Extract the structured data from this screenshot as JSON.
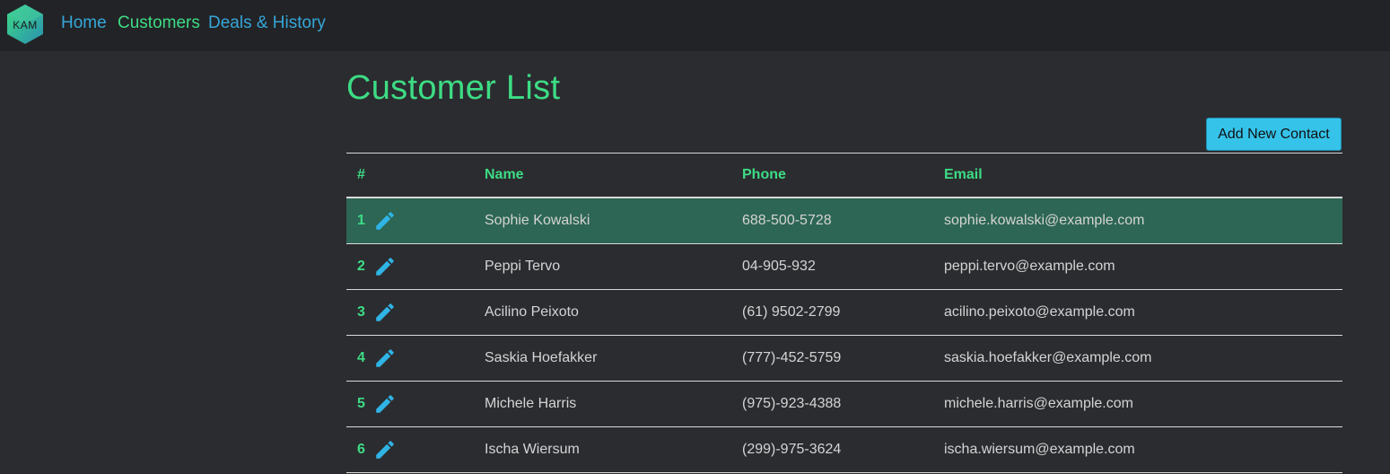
{
  "theme": {
    "accent_green": "#3ddc84",
    "accent_blue": "#35a7d9",
    "button_blue": "#35c3ea",
    "highlight_row": "#2d6654",
    "pencil_blue": "#2fb4e6"
  },
  "navbar": {
    "logo_text": "KAM",
    "links": [
      {
        "label": "Home"
      },
      {
        "label": "Customers"
      },
      {
        "label": "Deals & History"
      }
    ]
  },
  "page": {
    "title": "Customer List",
    "add_button_label": "Add New Contact"
  },
  "table": {
    "headers": [
      "#",
      "Name",
      "Phone",
      "Email"
    ],
    "rows": [
      {
        "num": "1",
        "name": "Sophie Kowalski",
        "phone": "688-500-5728",
        "email": "sophie.kowalski@example.com",
        "highlighted": true
      },
      {
        "num": "2",
        "name": "Peppi Tervo",
        "phone": "04-905-932",
        "email": "peppi.tervo@example.com",
        "highlighted": false
      },
      {
        "num": "3",
        "name": "Acilino Peixoto",
        "phone": "(61) 9502-2799",
        "email": "acilino.peixoto@example.com",
        "highlighted": false
      },
      {
        "num": "4",
        "name": "Saskia Hoefakker",
        "phone": "(777)-452-5759",
        "email": "saskia.hoefakker@example.com",
        "highlighted": false
      },
      {
        "num": "5",
        "name": "Michele Harris",
        "phone": "(975)-923-4388",
        "email": "michele.harris@example.com",
        "highlighted": false
      },
      {
        "num": "6",
        "name": "Ischa Wiersum",
        "phone": "(299)-975-3624",
        "email": "ischa.wiersum@example.com",
        "highlighted": false
      }
    ],
    "row_icon": "pencil-icon"
  }
}
